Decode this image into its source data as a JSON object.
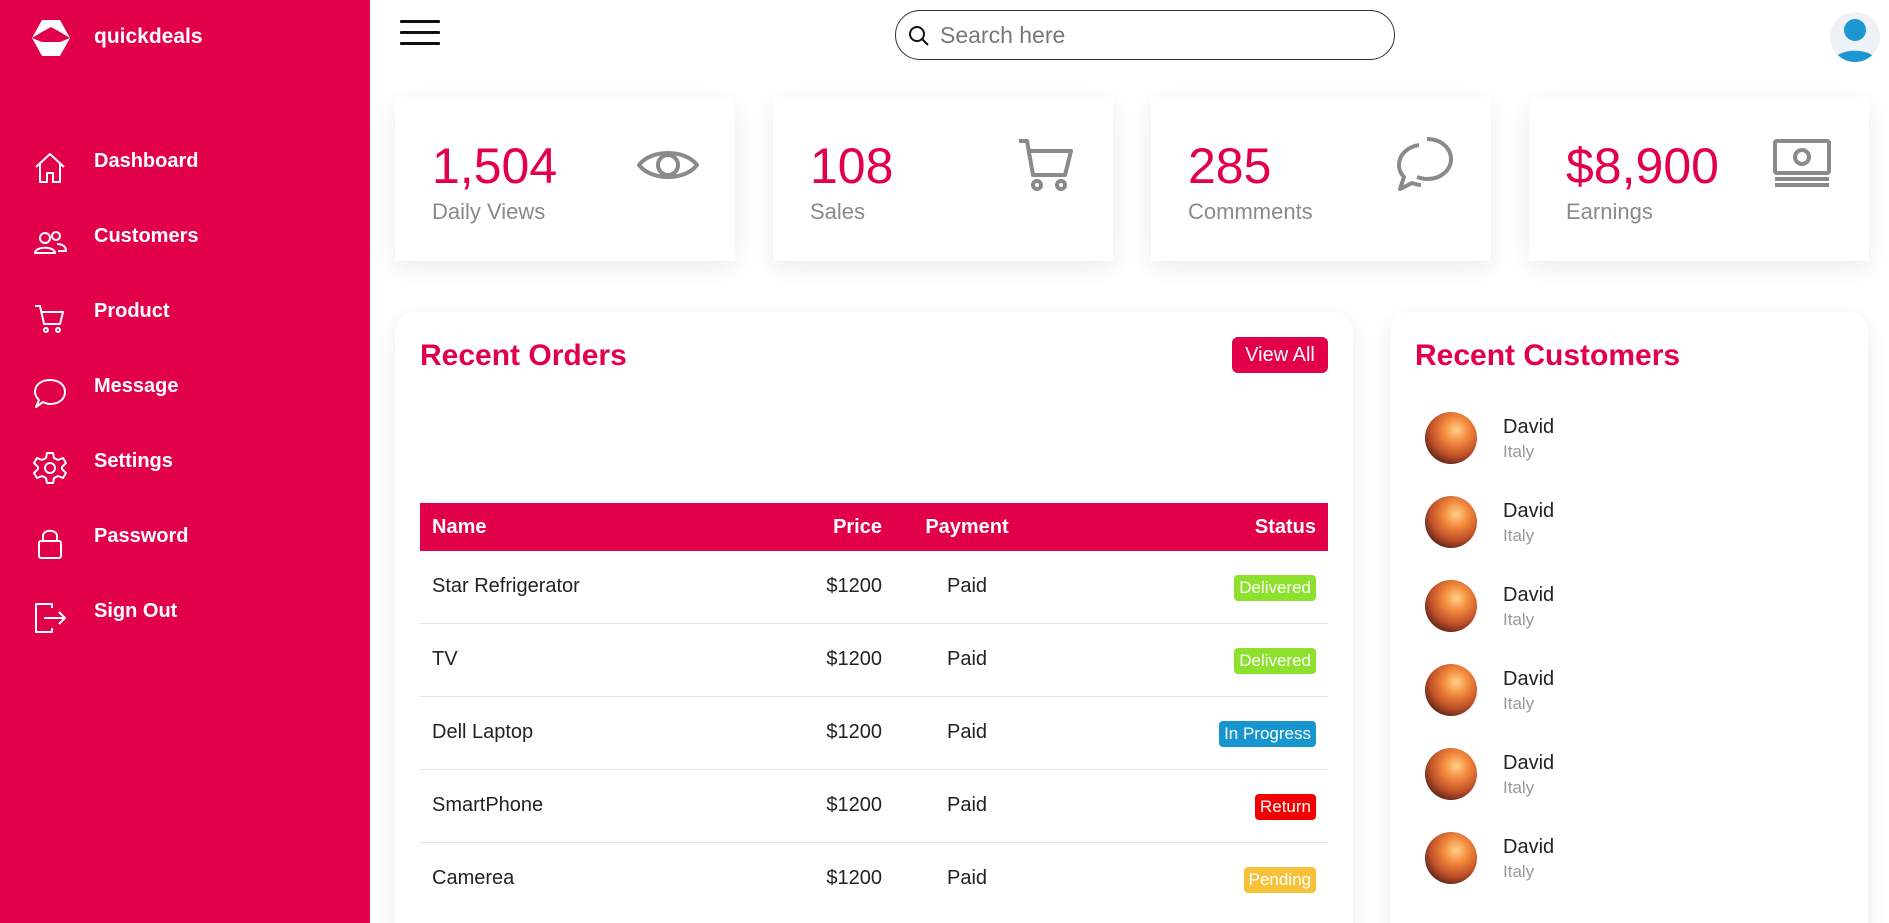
{
  "colors": {
    "brand": "#e2004a",
    "delivered": "#8de02c",
    "in_progress": "#1795ce",
    "return": "#f00000",
    "pending": "#f6c23a"
  },
  "brand": {
    "name": "quickdeals",
    "icon": "box-logo-icon"
  },
  "sidebar": {
    "items": [
      {
        "label": "Dashboard",
        "icon": "home-icon"
      },
      {
        "label": "Customers",
        "icon": "people-icon"
      },
      {
        "label": "Product",
        "icon": "cart-icon"
      },
      {
        "label": "Message",
        "icon": "chat-icon"
      },
      {
        "label": "Settings",
        "icon": "gear-icon"
      },
      {
        "label": "Password",
        "icon": "lock-icon"
      },
      {
        "label": "Sign Out",
        "icon": "sign-out-icon"
      }
    ]
  },
  "topbar": {
    "search_placeholder": "Search here"
  },
  "cards": [
    {
      "number": "1,504",
      "label": "Daily Views",
      "icon": "eye-icon"
    },
    {
      "number": "108",
      "label": "Sales",
      "icon": "cart-icon"
    },
    {
      "number": "285",
      "label": "Commments",
      "icon": "chat-icon"
    },
    {
      "number": "$8,900",
      "label": "Earnings",
      "icon": "cash-icon"
    }
  ],
  "orders": {
    "title": "Recent Orders",
    "view_all": "View All",
    "columns": [
      "Name",
      "Price",
      "Payment",
      "Status"
    ],
    "rows": [
      {
        "name": "Star Refrigerator",
        "price": "$1200",
        "payment": "Paid",
        "status": "Delivered",
        "status_color": "#8de02c"
      },
      {
        "name": "TV",
        "price": "$1200",
        "payment": "Paid",
        "status": "Delivered",
        "status_color": "#8de02c"
      },
      {
        "name": "Dell Laptop",
        "price": "$1200",
        "payment": "Paid",
        "status": "In Progress",
        "status_color": "#1795ce"
      },
      {
        "name": "SmartPhone",
        "price": "$1200",
        "payment": "Paid",
        "status": "Return",
        "status_color": "#f00000"
      },
      {
        "name": "Camerea",
        "price": "$1200",
        "payment": "Paid",
        "status": "Pending",
        "status_color": "#f6c23a"
      }
    ]
  },
  "customers": {
    "title": "Recent Customers",
    "items": [
      {
        "name": "David",
        "country": "Italy"
      },
      {
        "name": "David",
        "country": "Italy"
      },
      {
        "name": "David",
        "country": "Italy"
      },
      {
        "name": "David",
        "country": "Italy"
      },
      {
        "name": "David",
        "country": "Italy"
      },
      {
        "name": "David",
        "country": "Italy"
      }
    ]
  }
}
